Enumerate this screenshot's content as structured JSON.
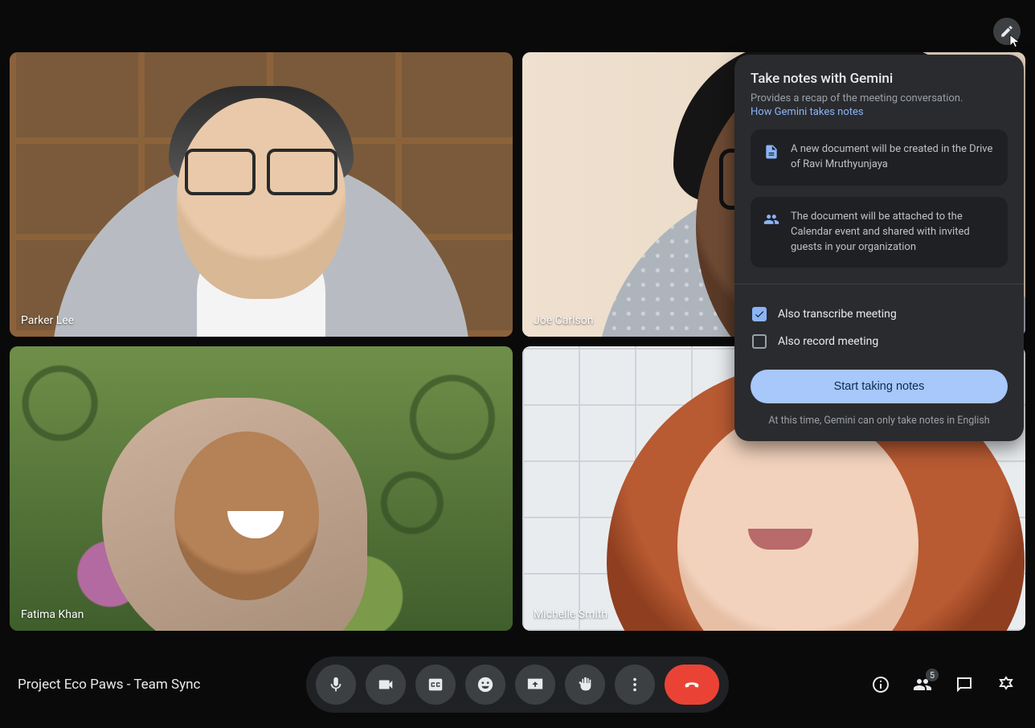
{
  "participants": [
    {
      "name": "Parker Lee"
    },
    {
      "name": "Joe Carlson",
      "speaking": true
    },
    {
      "name": "Fatima Khan"
    },
    {
      "name": "Michelle Smith"
    }
  ],
  "meeting_name": "Project Eco Paws - Team Sync",
  "participant_count": "5",
  "panel": {
    "title": "Take notes with Gemini",
    "subtitle": "Provides a recap of the meeting conversation.",
    "link": "How Gemini takes notes",
    "info1": "A new document will be created in the Drive of Ravi Mruthyunjaya",
    "info2": "The document will be attached to the Calendar event and shared with invited guests in your organization",
    "transcribe_label": "Also transcribe meeting",
    "transcribe_checked": true,
    "record_label": "Also record meeting",
    "record_checked": false,
    "button": "Start taking notes",
    "footnote": "At this time, Gemini can only take notes in English"
  },
  "icons": {
    "mic": "mic-icon",
    "camera": "camera-icon",
    "cc": "captions-icon",
    "emoji": "emoji-icon",
    "present": "present-icon",
    "hand": "raise-hand-icon",
    "more": "more-icon",
    "end": "end-call-icon",
    "info": "info-icon",
    "people": "people-icon",
    "chat": "chat-icon",
    "activities": "activities-icon",
    "edit": "pencil-icon"
  }
}
